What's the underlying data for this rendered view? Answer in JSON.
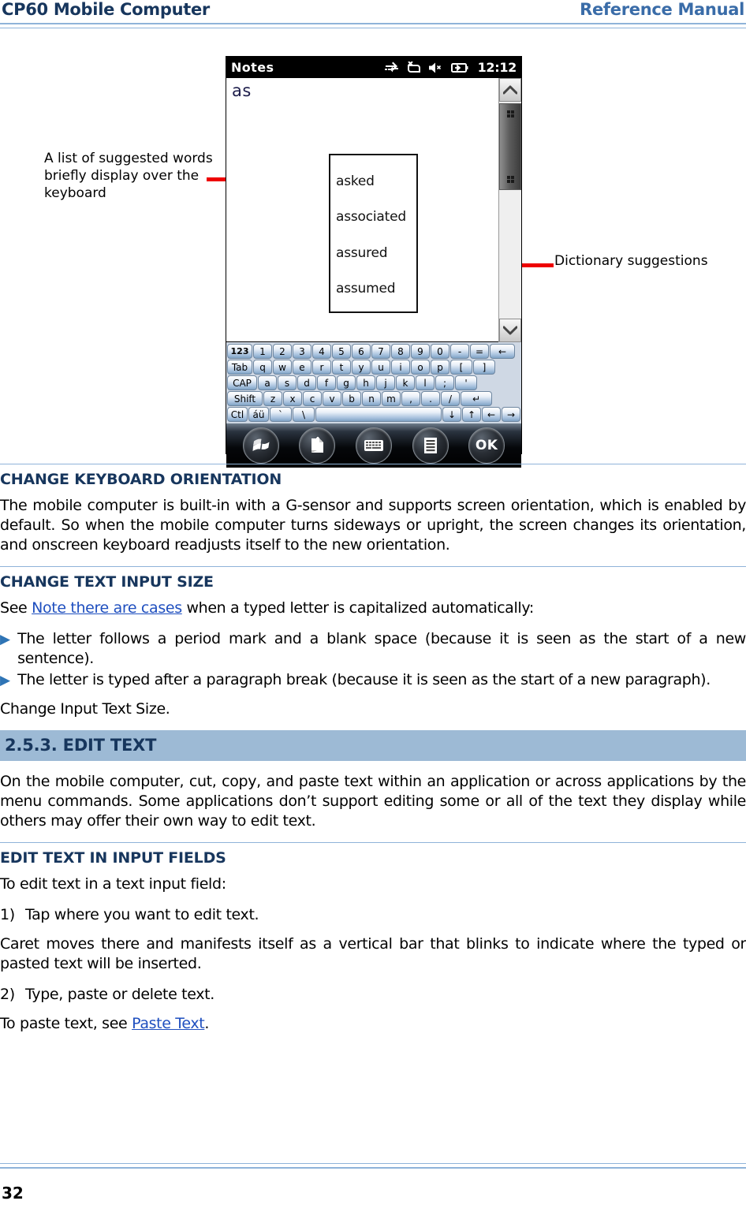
{
  "header": {
    "left_title": "CP60 Mobile Computer",
    "right_title": "Reference Manual"
  },
  "figure": {
    "annotation_left": "A list of suggested words briefly display over the keyboard",
    "annotation_right": "Dictionary suggestions",
    "device": {
      "app_title": "Notes",
      "status_icons": [
        "sync-arrows-icon",
        "no-network-icon",
        "mute-speaker-icon",
        "battery-charging-icon"
      ],
      "clock": "12:12",
      "typed_text": "as",
      "suggestions": [
        "asked",
        "associated",
        "assured",
        "assumed"
      ],
      "keyboard": {
        "row1": [
          "123",
          "1",
          "2",
          "3",
          "4",
          "5",
          "6",
          "7",
          "8",
          "9",
          "0",
          "-",
          "=",
          "←"
        ],
        "row2": [
          "Tab",
          "q",
          "w",
          "e",
          "r",
          "t",
          "y",
          "u",
          "i",
          "o",
          "p",
          "[",
          "]"
        ],
        "row3": [
          "CAP",
          "a",
          "s",
          "d",
          "f",
          "g",
          "h",
          "j",
          "k",
          "l",
          ";",
          "'"
        ],
        "row4": [
          "Shift",
          "z",
          "x",
          "c",
          "v",
          "b",
          "n",
          "m",
          ",",
          ".",
          "/",
          "↵"
        ],
        "row5": [
          "Ctl",
          "áü",
          "`",
          "\\",
          "",
          "↓",
          "↑",
          "←",
          "→"
        ]
      },
      "taskbar": {
        "start_label": "start-icon",
        "new_note_label": "new-note-icon",
        "keyboard_label": "keyboard-icon",
        "menu_label": "menu-icon",
        "ok_label": "OK"
      }
    }
  },
  "sections": {
    "keyboard_orientation": {
      "heading": "CHANGE KEYBOARD ORIENTATION",
      "paragraph": "The mobile computer is built-in with a G-sensor and supports screen orientation, which is enabled by default. So when the mobile computer turns sideways or upright, the screen changes its orientation, and onscreen keyboard readjusts itself to the new orientation."
    },
    "text_input_size": {
      "heading": "CHANGE TEXT INPUT SIZE",
      "intro_before_link": "See ",
      "intro_link": "Note there are cases",
      "intro_after_link": " when a typed letter is capitalized automatically:",
      "bullets": [
        "The letter follows a period mark and a blank space (because it is seen as the start of a new sentence).",
        "The letter is typed after a paragraph break (because it is seen as the start of a new paragraph)."
      ],
      "closing": "Change Input Text Size."
    },
    "edit_text": {
      "banner_heading": "2.5.3.  EDIT TEXT",
      "paragraph": "On the mobile computer, cut, copy, and paste text within an application or across applications by the menu commands. Some applications don’t support editing some or all of the text they display while others may offer their own way to edit text."
    },
    "edit_in_input_fields": {
      "heading": "EDIT TEXT IN INPUT FIELDS",
      "intro": "To edit text in a text input field:",
      "steps": [
        {
          "num": "1)",
          "text": "Tap where you want to edit text."
        },
        {
          "num": "2)",
          "text": "Type, paste or delete text."
        }
      ],
      "step1_note": "Caret moves there and manifests itself as a vertical bar that blinks to indicate where the typed or pasted text will be inserted.",
      "closing_before_link": "To paste text, see ",
      "closing_link": "Paste Text",
      "closing_after_link": "."
    }
  },
  "footer": {
    "page_number": "32"
  }
}
